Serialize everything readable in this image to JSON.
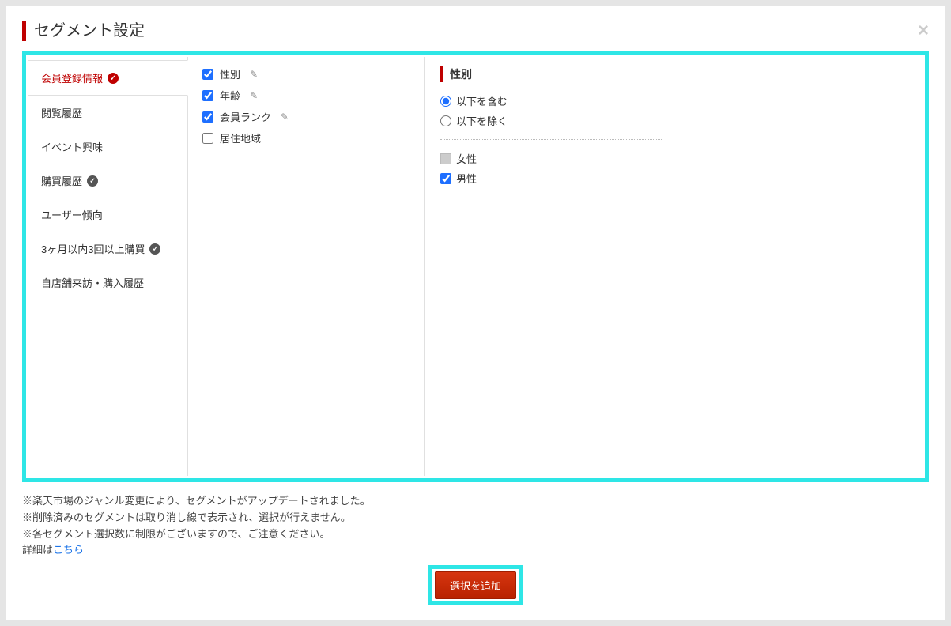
{
  "modal": {
    "title": "セグメント設定"
  },
  "sidebar": {
    "items": [
      {
        "label": "会員登録情報",
        "active": true,
        "badge": "red"
      },
      {
        "label": "閲覧履歴"
      },
      {
        "label": "イベント興味"
      },
      {
        "label": "購買履歴",
        "badge": "dark"
      },
      {
        "label": "ユーザー傾向"
      },
      {
        "label": "3ヶ月以内3回以上購買",
        "badge": "dark"
      },
      {
        "label": "自店舗来訪・購入履歴"
      }
    ]
  },
  "attributes": [
    {
      "label": "性別",
      "checked": true,
      "editable": true
    },
    {
      "label": "年齢",
      "checked": true,
      "editable": true
    },
    {
      "label": "会員ランク",
      "checked": true,
      "editable": true
    },
    {
      "label": "居住地域",
      "checked": false,
      "editable": false
    }
  ],
  "detail": {
    "title": "性別",
    "radios": [
      {
        "label": "以下を含む",
        "checked": true
      },
      {
        "label": "以下を除く",
        "checked": false
      }
    ],
    "options": [
      {
        "label": "女性",
        "checked": false,
        "disabled": true
      },
      {
        "label": "男性",
        "checked": true,
        "disabled": false
      }
    ]
  },
  "notes": {
    "line1": "※楽天市場のジャンル変更により、セグメントがアップデートされました。",
    "line2": "※削除済みのセグメントは取り消し線で表示され、選択が行えません。",
    "line3": "※各セグメント選択数に制限がございますので、ご注意ください。",
    "detail_prefix": "詳細は",
    "detail_link": "こちら"
  },
  "buttons": {
    "add_selection": "選択を追加"
  }
}
